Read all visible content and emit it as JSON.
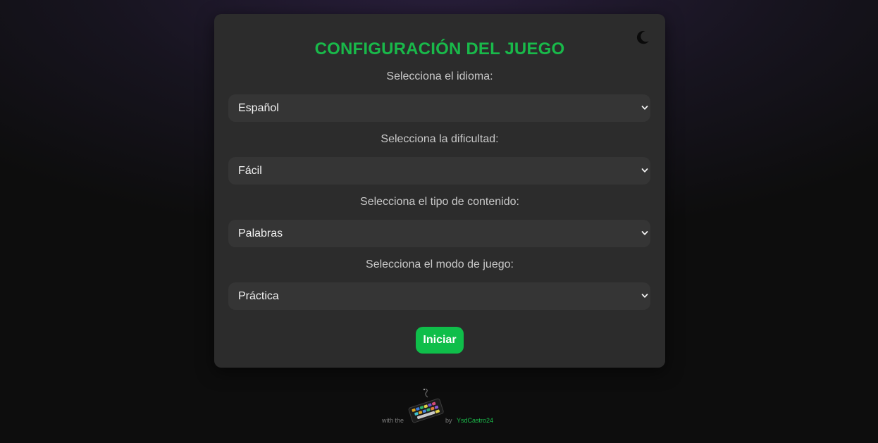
{
  "title": "CONFIGURACIÓN DEL JUEGO",
  "theme_toggle": {
    "icon": "moon-icon"
  },
  "fields": [
    {
      "label": "Selecciona el idioma:",
      "value": "Español"
    },
    {
      "label": "Selecciona la dificultad:",
      "value": "Fácil"
    },
    {
      "label": "Selecciona el tipo de contenido:",
      "value": "Palabras"
    },
    {
      "label": "Selecciona el modo de juego:",
      "value": "Práctica"
    }
  ],
  "start_button": {
    "label": "Iniciar"
  },
  "footer": {
    "with_text": "with the",
    "icon": "keyboard-icon",
    "by_text": "by",
    "author": "YsdCastro24"
  },
  "colors": {
    "accent": "#0fbe4a",
    "card": "#2c2c2c",
    "field": "#353535",
    "background": "#0d0d0d"
  }
}
